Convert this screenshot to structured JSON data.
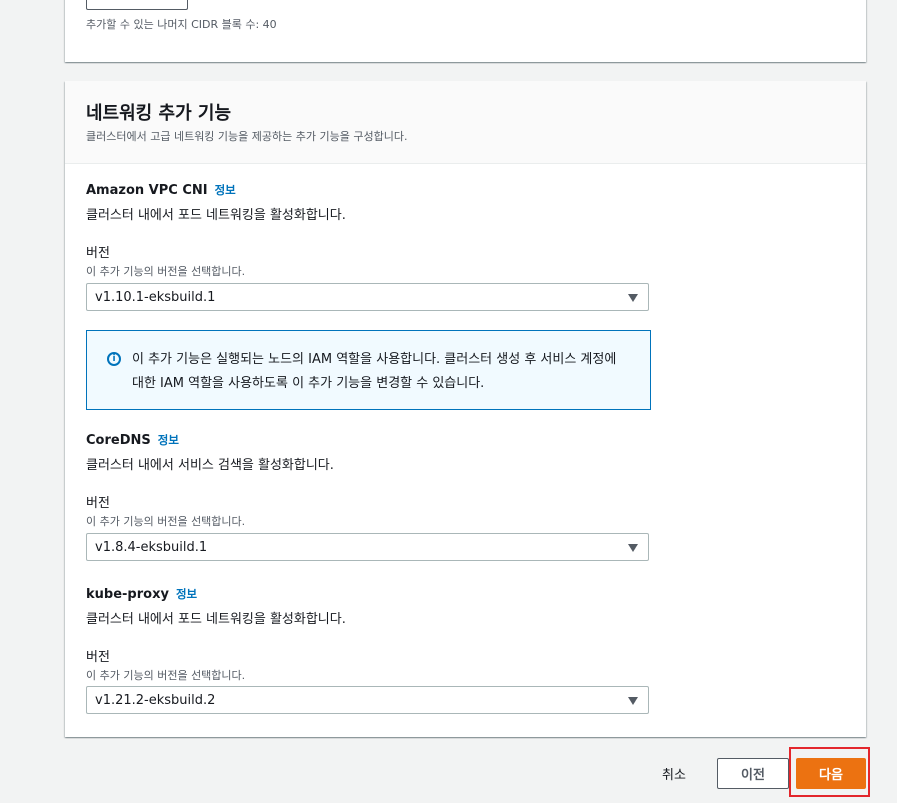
{
  "cidr": {
    "remaining_text": "추가할 수 있는 나머지 CIDR 블록 수: 40"
  },
  "addons_section": {
    "title": "네트워킹 추가 기능",
    "description": "클러스터에서 고급 네트워킹 기능을 제공하는 추가 기능을 구성합니다.",
    "info_label": "정보",
    "version_label": "버전",
    "version_description": "이 추가 기능의 버전을 선택합니다.",
    "addons": [
      {
        "name": "Amazon VPC CNI",
        "description": "클러스터 내에서 포드 네트워킹을 활성화합니다.",
        "version": "v1.10.1-eksbuild.1"
      },
      {
        "name": "CoreDNS",
        "description": "클러스터 내에서 서비스 검색을 활성화합니다.",
        "version": "v1.8.4-eksbuild.1"
      },
      {
        "name": "kube-proxy",
        "description": "클러스터 내에서 포드 네트워킹을 활성화합니다.",
        "version": "v1.21.2-eksbuild.2"
      }
    ],
    "iam_notice": "이 추가 기능은 실행되는 노드의 IAM 역할을 사용합니다. 클러스터 생성 후 서비스 계정에 대한 IAM 역할을 사용하도록 이 추가 기능을 변경할 수 있습니다."
  },
  "footer": {
    "cancel_label": "취소",
    "previous_label": "이전",
    "next_label": "다음"
  },
  "colors": {
    "accent": "#ec7211",
    "link": "#0073bb",
    "highlight": "#e3262c"
  },
  "icons": {
    "info": "info-circle-icon",
    "dropdown": "caret-down-icon"
  }
}
